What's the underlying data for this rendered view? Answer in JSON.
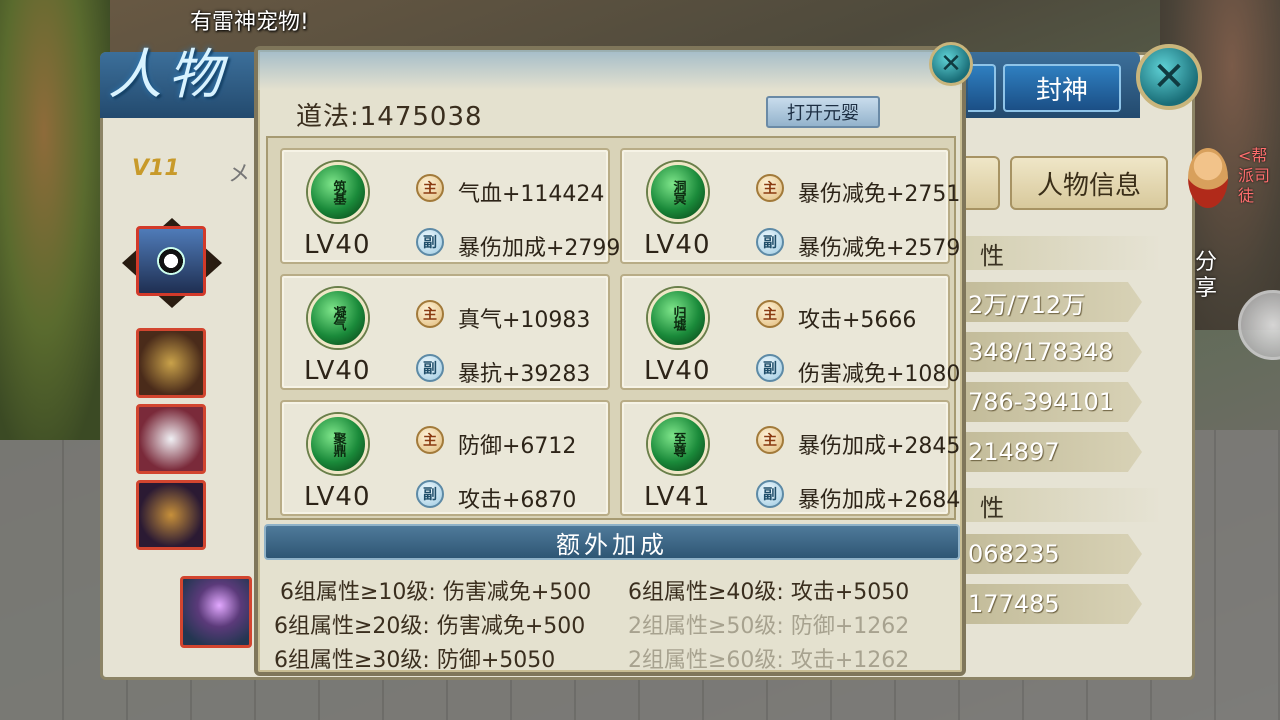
{
  "broadcast_text": "有雷神宠物!",
  "back_window": {
    "title": "人物",
    "tab_fengshen": "封神",
    "vip_level": "V11",
    "vip_name_partial": "メ",
    "tab_character_info": "人物信息",
    "section_1_partial": "性",
    "section_2_partial": "性",
    "stats_partial": [
      "2万/712万",
      "348/178348",
      "786-394101",
      "214897",
      "068235",
      "177485"
    ]
  },
  "side": {
    "guild_text": "<帮派司徒",
    "share_label": "分享"
  },
  "popup": {
    "daofa_label": "道法:",
    "daofa_value": "1475038",
    "open_button_label": "打开元婴",
    "main_badge": "主",
    "sub_badge": "副",
    "cards": [
      {
        "orb": "筑基",
        "level": "LV40",
        "main": "气血+114424",
        "sub": "暴伤加成+2799"
      },
      {
        "orb": "洞冥",
        "level": "LV40",
        "main": "暴伤减免+2751",
        "sub": "暴伤减免+2579"
      },
      {
        "orb": "凝气",
        "level": "LV40",
        "main": "真气+10983",
        "sub": "暴抗+39283"
      },
      {
        "orb": "归墟",
        "level": "LV40",
        "main": "攻击+5666",
        "sub": "伤害减免+1080"
      },
      {
        "orb": "聚鼎",
        "level": "LV40",
        "main": "防御+6712",
        "sub": "攻击+6870"
      },
      {
        "orb": "至尊",
        "level": "LV41",
        "main": "暴伤加成+2845",
        "sub": "暴伤加成+2684"
      }
    ],
    "extra_title": "额外加成",
    "bonuses": [
      {
        "text": "6组属性≥10级: 伤害减免+500",
        "active": true
      },
      {
        "text": "6组属性≥40级: 攻击+5050",
        "active": true
      },
      {
        "text": "6组属性≥20级: 伤害减免+500",
        "active": true
      },
      {
        "text": "2组属性≥50级: 防御+1262",
        "active": false
      },
      {
        "text": "6组属性≥30级: 防御+5050",
        "active": true
      },
      {
        "text": "2组属性≥60级: 攻击+1262",
        "active": false
      }
    ]
  }
}
